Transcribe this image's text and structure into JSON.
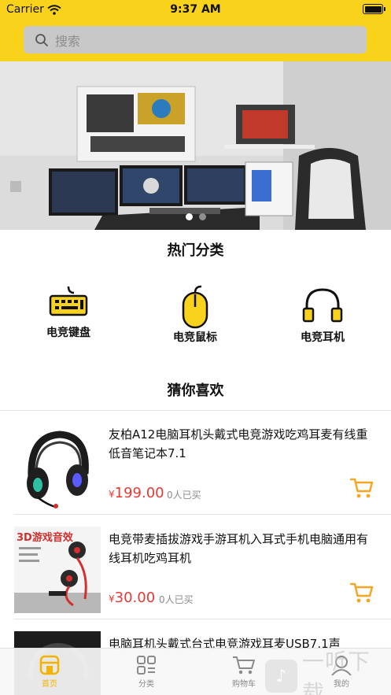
{
  "status_bar": {
    "carrier": "Carrier",
    "time": "9:37 AM"
  },
  "search": {
    "placeholder": "搜索"
  },
  "banner": {
    "slides": 2,
    "active_index": 0
  },
  "sections": {
    "categories_title": "热门分类",
    "recommend_title": "猜你喜欢"
  },
  "categories": [
    {
      "label": "电竞键盘",
      "icon": "keyboard-icon"
    },
    {
      "label": "电竞鼠标",
      "icon": "mouse-icon"
    },
    {
      "label": "电竞耳机",
      "icon": "headphones-icon"
    }
  ],
  "products": [
    {
      "title": "友柏A12电脑耳机头戴式电竞游戏吃鸡耳麦有线重低音笔记本7.1",
      "currency": "¥",
      "price": "199.00",
      "sold": "0人已买"
    },
    {
      "title": "电竞带麦插拔游戏手游耳机入耳式手机电脑通用有线耳机吃鸡耳机",
      "currency": "¥",
      "price": "30.00",
      "sold": "0人已买",
      "thumb_caption": "3D游戏音效"
    },
    {
      "title": "电脑耳机头戴式台式电竞游戏耳麦USB7.1声"
    }
  ],
  "tabbar": [
    {
      "label": "首页",
      "icon": "home-icon",
      "active": true
    },
    {
      "label": "分类",
      "icon": "grid-icon",
      "active": false
    },
    {
      "label": "购物车",
      "icon": "cart-icon",
      "active": false
    },
    {
      "label": "我的",
      "icon": "user-icon",
      "active": false
    }
  ],
  "watermark": {
    "text": "一听下载"
  },
  "colors": {
    "brand": "#f9d21c",
    "price": "#e53935",
    "cart": "#f5a623",
    "tab_active": "#f5b300"
  }
}
